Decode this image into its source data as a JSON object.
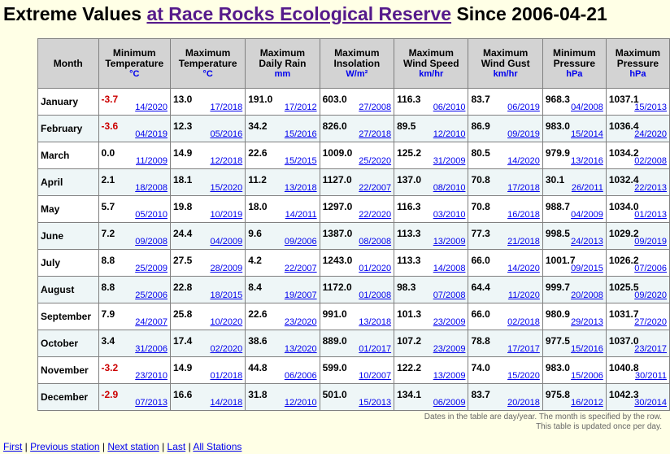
{
  "title_prefix": "Extreme Values",
  "title_link": "at Race Rocks Ecological Reserve",
  "title_suffix": "Since 2006-04-21",
  "headers": {
    "month": "Month",
    "columns": [
      {
        "label": "Minimum Temperature",
        "unit": "°C"
      },
      {
        "label": "Maximum Temperature",
        "unit": "°C"
      },
      {
        "label": "Maximum Daily Rain",
        "unit": "mm"
      },
      {
        "label": "Maximum Insolation",
        "unit": "W/m²"
      },
      {
        "label": "Maximum Wind Speed",
        "unit": "km/hr"
      },
      {
        "label": "Maximum Wind Gust",
        "unit": "km/hr"
      },
      {
        "label": "Minimum Pressure",
        "unit": "hPa"
      },
      {
        "label": "Maximum Pressure",
        "unit": "hPa"
      }
    ]
  },
  "rows": [
    {
      "month": "January",
      "cells": [
        {
          "v": "-3.7",
          "d": "14/2020",
          "neg": true
        },
        {
          "v": "13.0",
          "d": "17/2018"
        },
        {
          "v": "191.0",
          "d": "17/2012"
        },
        {
          "v": "603.0",
          "d": "27/2008"
        },
        {
          "v": "116.3",
          "d": "06/2010"
        },
        {
          "v": "83.7",
          "d": "06/2019"
        },
        {
          "v": "968.3",
          "d": "04/2008"
        },
        {
          "v": "1037.1",
          "d": "15/2013"
        }
      ]
    },
    {
      "month": "February",
      "cells": [
        {
          "v": "-3.6",
          "d": "04/2019",
          "neg": true
        },
        {
          "v": "12.3",
          "d": "05/2016"
        },
        {
          "v": "34.2",
          "d": "15/2016"
        },
        {
          "v": "826.0",
          "d": "27/2018"
        },
        {
          "v": "89.5",
          "d": "12/2010"
        },
        {
          "v": "86.9",
          "d": "09/2019"
        },
        {
          "v": "983.0",
          "d": "15/2014"
        },
        {
          "v": "1036.4",
          "d": "24/2020"
        }
      ]
    },
    {
      "month": "March",
      "cells": [
        {
          "v": "0.0",
          "d": "11/2009"
        },
        {
          "v": "14.9",
          "d": "12/2018"
        },
        {
          "v": "22.6",
          "d": "15/2015"
        },
        {
          "v": "1009.0",
          "d": "25/2020"
        },
        {
          "v": "125.2",
          "d": "31/2009"
        },
        {
          "v": "80.5",
          "d": "14/2020"
        },
        {
          "v": "979.9",
          "d": "13/2016"
        },
        {
          "v": "1034.2",
          "d": "02/2008"
        }
      ]
    },
    {
      "month": "April",
      "cells": [
        {
          "v": "2.1",
          "d": "18/2008"
        },
        {
          "v": "18.1",
          "d": "15/2020"
        },
        {
          "v": "11.2",
          "d": "13/2018"
        },
        {
          "v": "1127.0",
          "d": "22/2007"
        },
        {
          "v": "137.0",
          "d": "08/2010"
        },
        {
          "v": "70.8",
          "d": "17/2018"
        },
        {
          "v": "30.1",
          "d": "26/2011"
        },
        {
          "v": "1032.4",
          "d": "22/2013"
        }
      ]
    },
    {
      "month": "May",
      "cells": [
        {
          "v": "5.7",
          "d": "05/2010"
        },
        {
          "v": "19.8",
          "d": "10/2019"
        },
        {
          "v": "18.0",
          "d": "14/2011"
        },
        {
          "v": "1297.0",
          "d": "22/2020"
        },
        {
          "v": "116.3",
          "d": "03/2010"
        },
        {
          "v": "70.8",
          "d": "16/2018"
        },
        {
          "v": "988.7",
          "d": "04/2009"
        },
        {
          "v": "1034.0",
          "d": "01/2013"
        }
      ]
    },
    {
      "month": "June",
      "cells": [
        {
          "v": "7.2",
          "d": "09/2008"
        },
        {
          "v": "24.4",
          "d": "04/2009"
        },
        {
          "v": "9.6",
          "d": "09/2006"
        },
        {
          "v": "1387.0",
          "d": "08/2008"
        },
        {
          "v": "113.3",
          "d": "13/2009"
        },
        {
          "v": "77.3",
          "d": "21/2018"
        },
        {
          "v": "998.5",
          "d": "24/2013"
        },
        {
          "v": "1029.2",
          "d": "09/2019"
        }
      ]
    },
    {
      "month": "July",
      "cells": [
        {
          "v": "8.8",
          "d": "25/2009"
        },
        {
          "v": "27.5",
          "d": "28/2009"
        },
        {
          "v": "4.2",
          "d": "22/2007"
        },
        {
          "v": "1243.0",
          "d": "01/2020"
        },
        {
          "v": "113.3",
          "d": "14/2008"
        },
        {
          "v": "66.0",
          "d": "14/2020"
        },
        {
          "v": "1001.7",
          "d": "09/2015"
        },
        {
          "v": "1026.2",
          "d": "07/2006"
        }
      ]
    },
    {
      "month": "August",
      "cells": [
        {
          "v": "8.8",
          "d": "25/2006"
        },
        {
          "v": "22.8",
          "d": "18/2015"
        },
        {
          "v": "8.4",
          "d": "19/2007"
        },
        {
          "v": "1172.0",
          "d": "01/2008"
        },
        {
          "v": "98.3",
          "d": "07/2008"
        },
        {
          "v": "64.4",
          "d": "11/2020"
        },
        {
          "v": "999.7",
          "d": "20/2008"
        },
        {
          "v": "1025.5",
          "d": "09/2020"
        }
      ]
    },
    {
      "month": "September",
      "cells": [
        {
          "v": "7.9",
          "d": "24/2007"
        },
        {
          "v": "25.8",
          "d": "10/2020"
        },
        {
          "v": "22.6",
          "d": "23/2020"
        },
        {
          "v": "991.0",
          "d": "13/2018"
        },
        {
          "v": "101.3",
          "d": "23/2009"
        },
        {
          "v": "66.0",
          "d": "02/2018"
        },
        {
          "v": "980.9",
          "d": "29/2013"
        },
        {
          "v": "1031.7",
          "d": "27/2020"
        }
      ]
    },
    {
      "month": "October",
      "cells": [
        {
          "v": "3.4",
          "d": "31/2006"
        },
        {
          "v": "17.4",
          "d": "02/2020"
        },
        {
          "v": "38.6",
          "d": "13/2020"
        },
        {
          "v": "889.0",
          "d": "01/2017"
        },
        {
          "v": "107.2",
          "d": "23/2009"
        },
        {
          "v": "78.8",
          "d": "17/2017"
        },
        {
          "v": "977.5",
          "d": "15/2016"
        },
        {
          "v": "1037.0",
          "d": "23/2017"
        }
      ]
    },
    {
      "month": "November",
      "cells": [
        {
          "v": "-3.2",
          "d": "23/2010",
          "neg": true
        },
        {
          "v": "14.9",
          "d": "01/2018"
        },
        {
          "v": "44.8",
          "d": "06/2006"
        },
        {
          "v": "599.0",
          "d": "10/2007"
        },
        {
          "v": "122.2",
          "d": "13/2009"
        },
        {
          "v": "74.0",
          "d": "15/2020"
        },
        {
          "v": "983.0",
          "d": "15/2006"
        },
        {
          "v": "1040.8",
          "d": "30/2011"
        }
      ]
    },
    {
      "month": "December",
      "cells": [
        {
          "v": "-2.9",
          "d": "07/2013",
          "neg": true
        },
        {
          "v": "16.6",
          "d": "14/2018"
        },
        {
          "v": "31.8",
          "d": "12/2010"
        },
        {
          "v": "501.0",
          "d": "15/2013"
        },
        {
          "v": "134.1",
          "d": "06/2009"
        },
        {
          "v": "83.7",
          "d": "20/2018"
        },
        {
          "v": "975.8",
          "d": "16/2012"
        },
        {
          "v": "1042.3",
          "d": "30/2014"
        }
      ]
    }
  ],
  "note_line1": "Dates in the table are day/year. The month is specified by the row.",
  "note_line2": "This table is updated once per day.",
  "nav": {
    "first": "First",
    "previous": "Previous station",
    "next": "Next station",
    "last": "Last",
    "all": "All Stations",
    "sep": "|"
  }
}
